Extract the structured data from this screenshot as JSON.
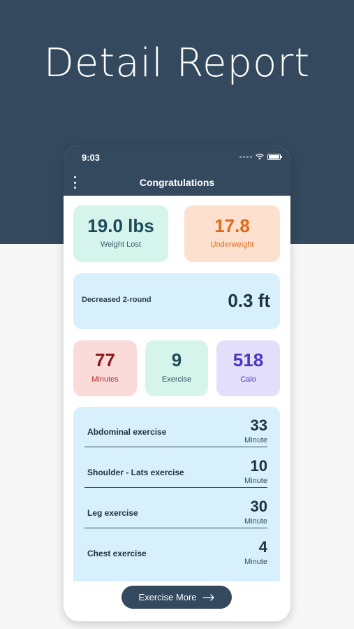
{
  "headline": "Detail Report",
  "status_bar": {
    "time": "9:03"
  },
  "header": {
    "title": "Congratulations"
  },
  "summary": {
    "weight_lost": {
      "value": "19.0 lbs",
      "label": "Weight Lost"
    },
    "bmi": {
      "value": "17.8",
      "label": "Underweight"
    }
  },
  "decrease": {
    "label": "Decreased 2-round",
    "value": "0.3 ft"
  },
  "stats": {
    "minutes": {
      "value": "77",
      "label": "Minutes"
    },
    "exercise": {
      "value": "9",
      "label": "Exercise"
    },
    "calories": {
      "value": "518",
      "label": "Calo"
    }
  },
  "exercises": [
    {
      "name": "Abdominal exercise",
      "value": "33",
      "unit": "Minute"
    },
    {
      "name": "Shoulder - Lats exercise",
      "value": "10",
      "unit": "Minute"
    },
    {
      "name": "Leg exercise",
      "value": "30",
      "unit": "Minute"
    },
    {
      "name": "Chest exercise",
      "value": "4",
      "unit": "Minute"
    }
  ],
  "action": {
    "label": "Exercise More"
  },
  "colors": {
    "brand_dark": "#34495e",
    "weight_bg": "#d5f5ec",
    "underweight_bg": "#fde0cd",
    "decrease_bg": "#d7f0fb",
    "minutes_bg": "#fbdada",
    "exercise_bg": "#d6f5ea",
    "calo_bg": "#e3dffb",
    "underweight_text": "#e06a1b",
    "minutes_text": "#8c1a1a",
    "calo_text": "#4a35c7"
  }
}
